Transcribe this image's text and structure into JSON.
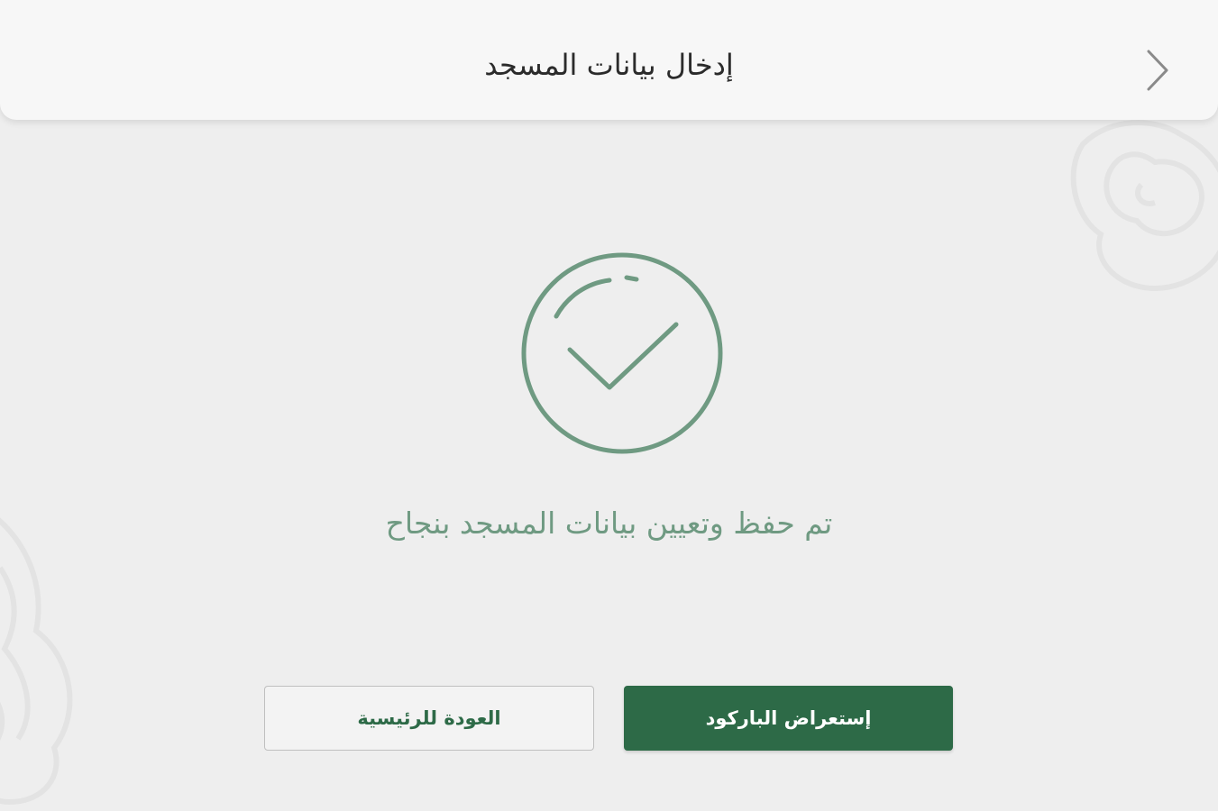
{
  "header": {
    "title": "إدخال بيانات المسجد",
    "back_icon": "chevron-right-icon"
  },
  "status": {
    "icon": "check-circle-icon",
    "message": "تم حفظ وتعيين بيانات المسجد  بنجاح"
  },
  "actions": {
    "view_barcode_label": "إستعراض الباركود",
    "back_home_label": "العودة للرئيسية"
  },
  "colors": {
    "brand_green": "#2d6a47",
    "badge_green": "#6f9a82",
    "background": "#eeeeee",
    "header_background": "#f7f7f7"
  }
}
